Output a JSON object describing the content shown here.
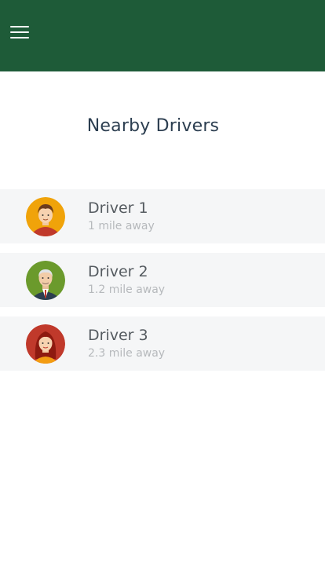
{
  "header": {
    "menu_icon": "hamburger-menu-icon",
    "background_color": "#1e5b38"
  },
  "page": {
    "title": "Nearby Drivers"
  },
  "drivers": [
    {
      "name": "Driver 1",
      "distance": "1 mile away",
      "avatar_icon": "young-man-avatar-icon",
      "avatar_color": "#f0a30a"
    },
    {
      "name": "Driver 2",
      "distance": "1.2 mile away",
      "avatar_icon": "old-man-avatar-icon",
      "avatar_color": "#6b9a2c"
    },
    {
      "name": "Driver 3",
      "distance": "2.3 mile away",
      "avatar_icon": "woman-avatar-icon",
      "avatar_color": "#c0392b"
    }
  ]
}
